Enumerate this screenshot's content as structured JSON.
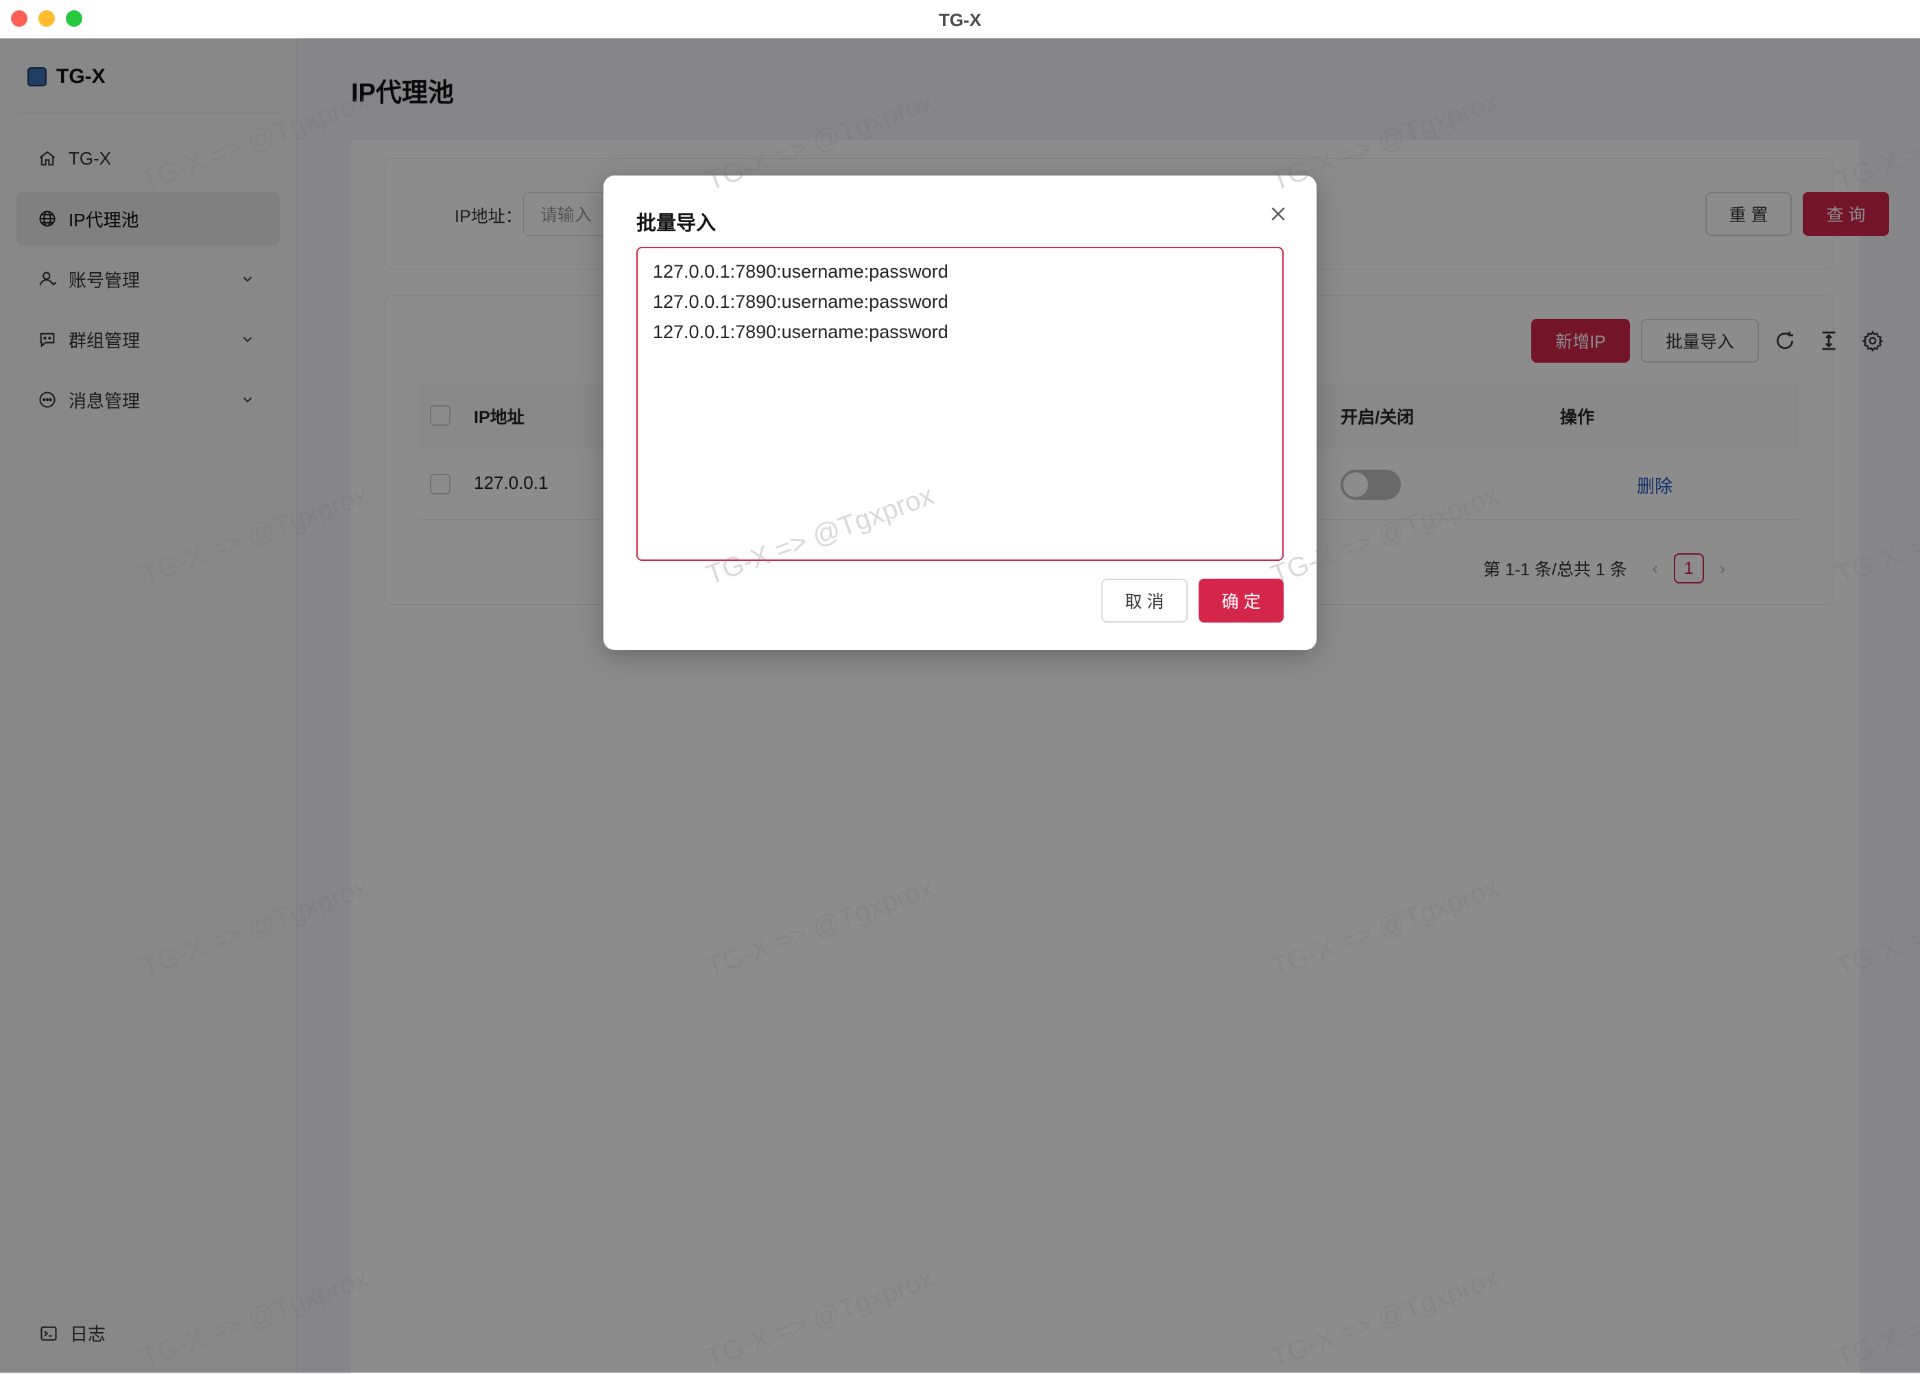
{
  "window": {
    "title": "TG-X"
  },
  "sidebar": {
    "brand": "TG-X",
    "items": [
      {
        "label": "TG-X",
        "icon": "home-icon"
      },
      {
        "label": "IP代理池",
        "icon": "globe-icon",
        "active": true
      },
      {
        "label": "账号管理",
        "icon": "user-icon",
        "expandable": true
      },
      {
        "label": "群组管理",
        "icon": "group-chat-icon",
        "expandable": true
      },
      {
        "label": "消息管理",
        "icon": "message-icon",
        "expandable": true
      }
    ],
    "footer": {
      "label": "日志",
      "icon": "terminal-icon"
    }
  },
  "page": {
    "title": "IP代理池"
  },
  "search": {
    "label": "IP地址：",
    "placeholder": "请输入",
    "reset_label": "重 置",
    "query_label": "查 询"
  },
  "toolbar": {
    "add_label": "新增IP",
    "import_label": "批量导入"
  },
  "table": {
    "columns": {
      "ip": "IP地址",
      "toggle": "开启/关闭",
      "actions": "操作"
    },
    "rows": [
      {
        "ip": "127.0.0.1",
        "enabled": false,
        "action": "删除"
      }
    ]
  },
  "pagination": {
    "summary": "第 1-1 条/总共 1 条",
    "current_page": "1"
  },
  "modal": {
    "title": "批量导入",
    "lines": [
      "127.0.0.1:7890:username:password",
      "127.0.0.1:7890:username:password",
      "127.0.0.1:7890:username:password"
    ],
    "cancel_label": "取 消",
    "ok_label": "确 定"
  },
  "watermark": "TG-X => @Tgxprox",
  "colors": {
    "primary": "#d4264a",
    "link": "#1f58c6",
    "overlay": "rgba(0,0,0,0.45)"
  }
}
